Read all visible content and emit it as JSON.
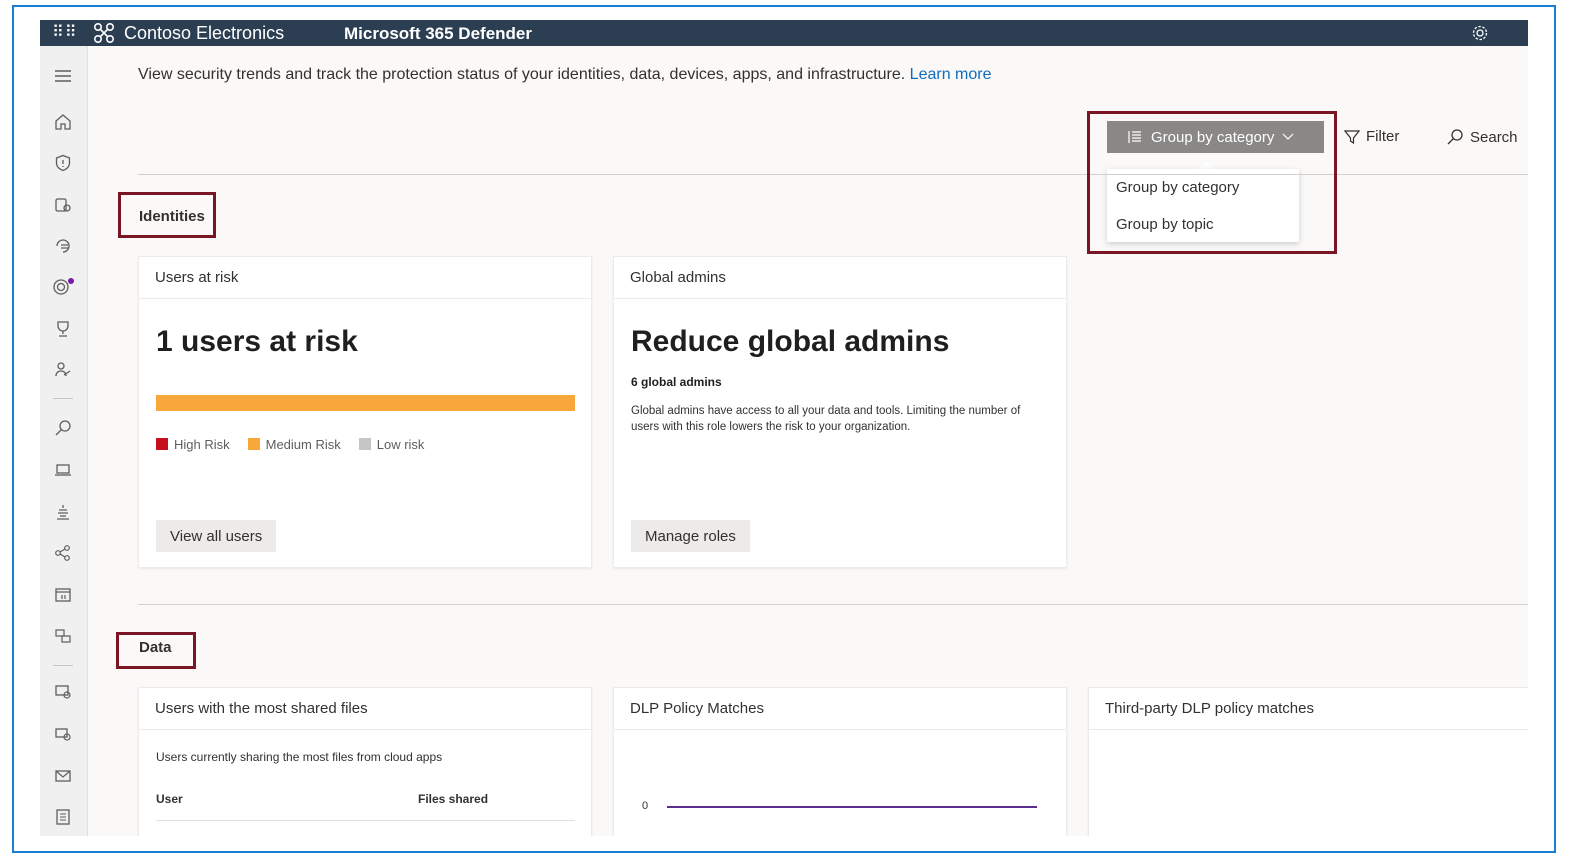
{
  "topbar": {
    "org_name": "Contoso Electronics",
    "product_name": "Microsoft 365 Defender",
    "bg_color": "#2b3e52"
  },
  "leftnav": {
    "icons": [
      "menu-icon",
      "home-icon",
      "shield-icon",
      "incidents-icon",
      "hunting-icon",
      "threat-analytics-icon",
      "secure-score-icon",
      "learning-hub-icon",
      "search-icon",
      "device-icon",
      "vulnerability-icon",
      "partner-icon",
      "evaluation-icon",
      "assets-icon",
      "email-collab-icon",
      "cloud-apps-icon",
      "mail-icon",
      "reports-icon"
    ]
  },
  "intro": {
    "text": "View security trends and track the protection status of your identities, data, devices, apps, and infrastructure.",
    "link": "Learn more"
  },
  "toolbar": {
    "group_label": "Group by category",
    "filter_label": "Filter",
    "search_label": "Search"
  },
  "group_dropdown": {
    "options": [
      "Group by category",
      "Group by topic"
    ]
  },
  "sections": {
    "identities": {
      "title": "Identities",
      "users_at_risk": {
        "header": "Users at risk",
        "headline": "1 users at risk",
        "legend": [
          "High Risk",
          "Medium Risk",
          "Low risk"
        ],
        "legend_colors": [
          "#c50f1f",
          "#f8a73a",
          "#c8c6c4"
        ],
        "medium_risk_fraction": 1.0,
        "button": "View all users"
      },
      "global_admins": {
        "header": "Global admins",
        "headline": "Reduce global admins",
        "count": "6 global admins",
        "description": "Global admins have access to all your data and tools. Limiting the number of users with this role lowers the risk to your organization.",
        "button": "Manage roles"
      }
    },
    "data": {
      "title": "Data",
      "shared_files": {
        "header": "Users with the most shared files",
        "subtitle": "Users currently sharing the most files from cloud apps",
        "col_user": "User",
        "col_files": "Files shared"
      },
      "dlp": {
        "header": "DLP Policy Matches",
        "axis_zero": "0"
      },
      "third_party": {
        "header": "Third-party DLP policy matches"
      }
    }
  },
  "highlight_color": "#7a1526"
}
